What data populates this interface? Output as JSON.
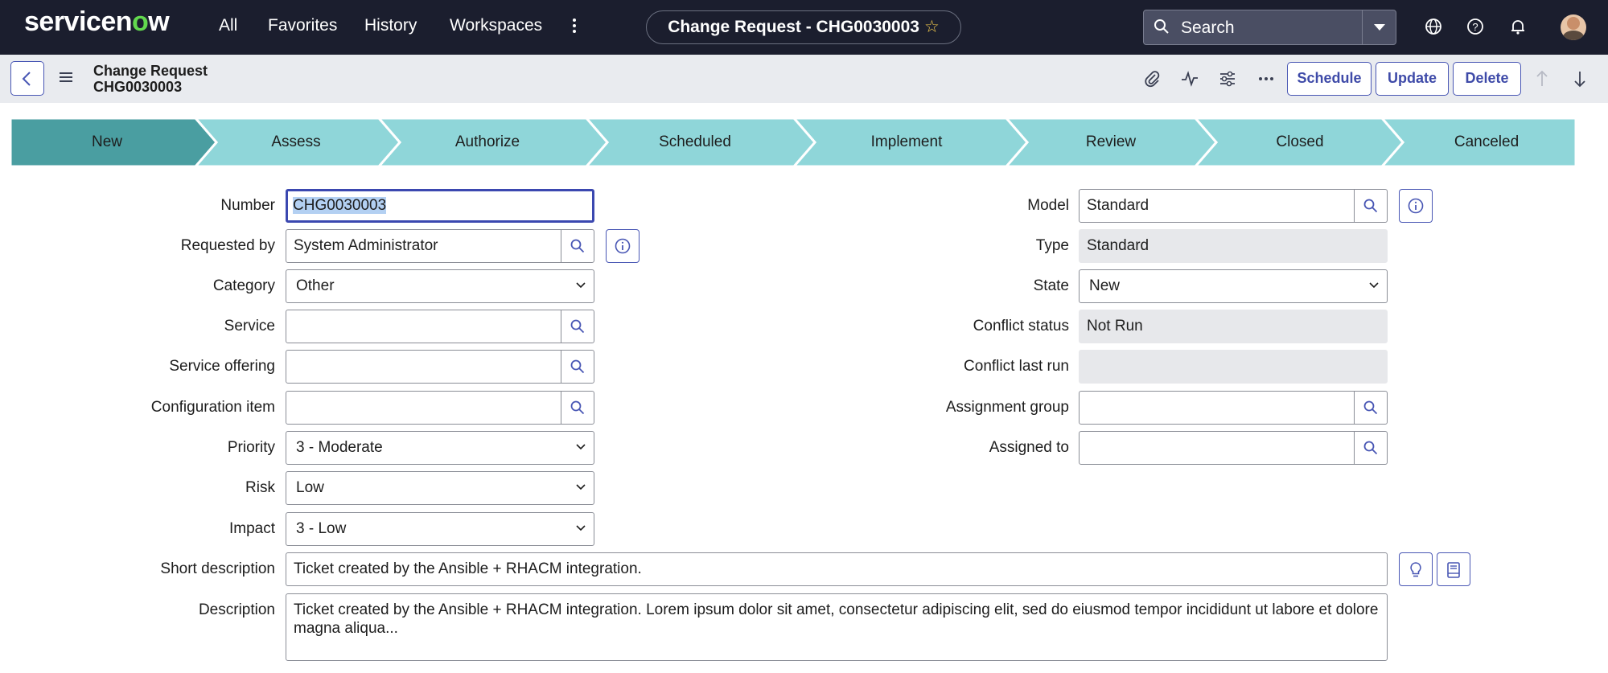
{
  "nav": {
    "logo_main": "servicen",
    "logo_o": "o",
    "logo_end": "w",
    "links": [
      "All",
      "Favorites",
      "History",
      "Workspaces"
    ],
    "title": "Change Request - CHG0030003",
    "star": "☆",
    "search_placeholder": "Search"
  },
  "header": {
    "record_type": "Change Request",
    "record_number": "CHG0030003",
    "buttons": {
      "schedule": "Schedule",
      "update": "Update",
      "delete": "Delete"
    }
  },
  "flow": {
    "stages": [
      "New",
      "Assess",
      "Authorize",
      "Scheduled",
      "Implement",
      "Review",
      "Closed",
      "Canceled"
    ],
    "active_index": 0,
    "colors": {
      "active": "#4a9ea1",
      "inactive": "#8fd6d9"
    }
  },
  "form": {
    "left": {
      "number": {
        "label": "Number",
        "value": "CHG0030003"
      },
      "requested_by": {
        "label": "Requested by",
        "value": "System Administrator"
      },
      "category": {
        "label": "Category",
        "value": "Other"
      },
      "service": {
        "label": "Service",
        "value": ""
      },
      "service_offering": {
        "label": "Service offering",
        "value": ""
      },
      "configuration_item": {
        "label": "Configuration item",
        "value": ""
      },
      "priority": {
        "label": "Priority",
        "value": "3 - Moderate"
      },
      "risk": {
        "label": "Risk",
        "value": "Low"
      },
      "impact": {
        "label": "Impact",
        "value": "3 - Low"
      }
    },
    "right": {
      "model": {
        "label": "Model",
        "value": "Standard"
      },
      "type": {
        "label": "Type",
        "value": "Standard"
      },
      "state": {
        "label": "State",
        "value": "New"
      },
      "conflict_status": {
        "label": "Conflict status",
        "value": "Not Run"
      },
      "conflict_last_run": {
        "label": "Conflict last run",
        "value": ""
      },
      "assignment_group": {
        "label": "Assignment group",
        "value": ""
      },
      "assigned_to": {
        "label": "Assigned to",
        "value": ""
      }
    },
    "short_description": {
      "label": "Short description",
      "value": "Ticket created by the Ansible + RHACM integration."
    },
    "description": {
      "label": "Description",
      "value": "Ticket created by the Ansible + RHACM integration. Lorem ipsum dolor sit amet, consectetur adipiscing elit, sed do eiusmod tempor incididunt ut labore et dolore magna aliqua..."
    }
  },
  "colors": {
    "nav_bg": "#1b1e2e",
    "accent": "#4856b4",
    "subheader_bg": "#e9ebef"
  }
}
